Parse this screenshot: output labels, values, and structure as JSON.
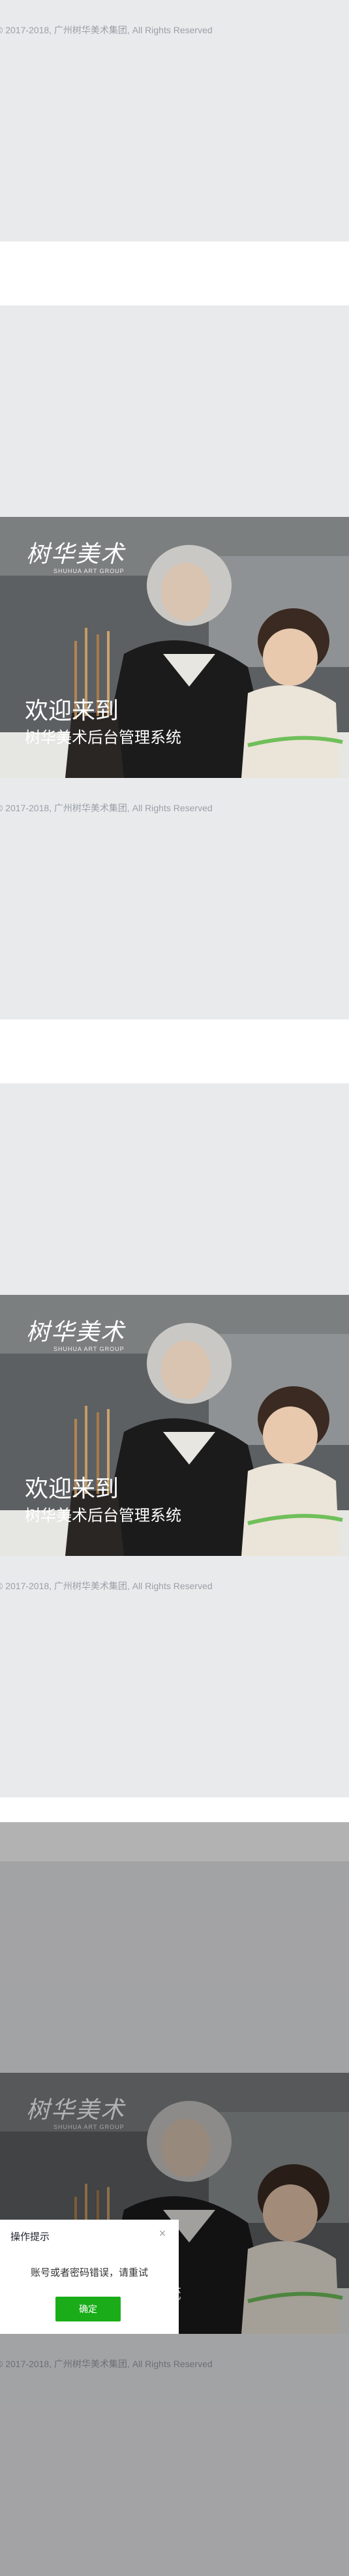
{
  "footer": {
    "copyright": "© 2017-2018, 广州树华美术集团, All Rights Reserved"
  },
  "brand": {
    "logo_cn": "树华美术",
    "logo_en": "SHUHUA ART GROUP"
  },
  "hero": {
    "welcome": "欢迎来到",
    "subtitle": "树华美术后台管理系统"
  },
  "dialog": {
    "title": "操作提示",
    "message": "账号或者密码错误，请重试",
    "confirm_label": "确定",
    "close_icon": "close-icon"
  },
  "colors": {
    "page_bg": "#e9eaec",
    "confirm": "#1aad19",
    "footer_text": "#9aa0a6"
  }
}
